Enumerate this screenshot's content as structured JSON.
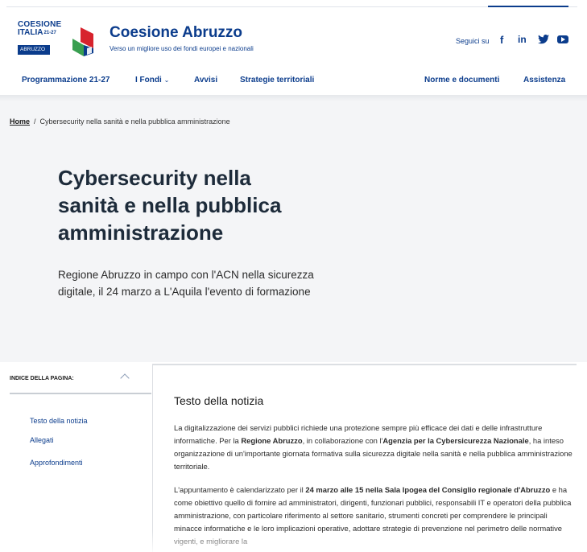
{
  "header": {
    "logo_line1": "COESIONE",
    "logo_line2": "ITALIA",
    "logo_sup": "21-27",
    "logo_badge": "ABRUZZO",
    "title": "Coesione Abruzzo",
    "subtitle": "Verso un migliore uso dei fondi europei e nazionali",
    "social_label": "Seguici su",
    "social_icons": [
      "facebook-icon",
      "linkedin-icon",
      "twitter-icon",
      "youtube-icon"
    ]
  },
  "nav": {
    "items": [
      "Programmazione 21-27",
      "I Fondi",
      "Avvisi",
      "Strategie territoriali",
      "Norme e documenti",
      "Assistenza"
    ],
    "dropdown_glyph": "⌄"
  },
  "breadcrumb": {
    "home": "Home",
    "separator": "/",
    "current": "Cybersecurity nella sanità e nella pubblica amministrazione"
  },
  "article": {
    "title": "Cybersecurity nella sanità e nella pubblica amministrazione",
    "lead": "Regione Abruzzo in campo con l'ACN nella sicurezza digitale, il 24 marzo a L'Aquila l'evento di formazione"
  },
  "index": {
    "title": "INDICE DELLA PAGINA:",
    "items": [
      "Testo della notizia",
      "Allegati",
      "Approfondimenti"
    ]
  },
  "body": {
    "section_title": "Testo della notizia",
    "p1_a": "La digitalizzazione dei servizi pubblici richiede una protezione sempre più efficace dei dati e delle infrastrutture informatiche. Per la ",
    "p1_b": "Regione Abruzzo",
    "p1_c": ", in collaborazione con l'",
    "p1_d": "Agenzia per la Cybersicurezza Nazionale",
    "p1_e": ", ha inteso organizzazione di un'importante giornata formativa sulla sicurezza digitale nella sanità e nella pubblica amministrazione territoriale.",
    "p2_a": "L'appuntamento è calendarizzato per il ",
    "p2_b": "24 marzo alle 15 nella Sala Ipogea del Consiglio regionale d'Abruzzo",
    "p2_c": " e ha come obiettivo quello di  fornire ad amministratori, dirigenti, funzionari pubblici, responsabili IT e operatori della pubblica amministrazione, con particolare riferimento al settore sanitario, strumenti concreti per comprendere le principali minacce informatiche e le loro implicazioni operative, adottare strategie di prevenzione nel perimetro delle normative vigenti, e migliorare la"
  },
  "colors": {
    "brand": "#0b3c8c",
    "logo_red": "#d7232d",
    "logo_green": "#2e9a47",
    "hero_bg": "#f4f5f7"
  }
}
